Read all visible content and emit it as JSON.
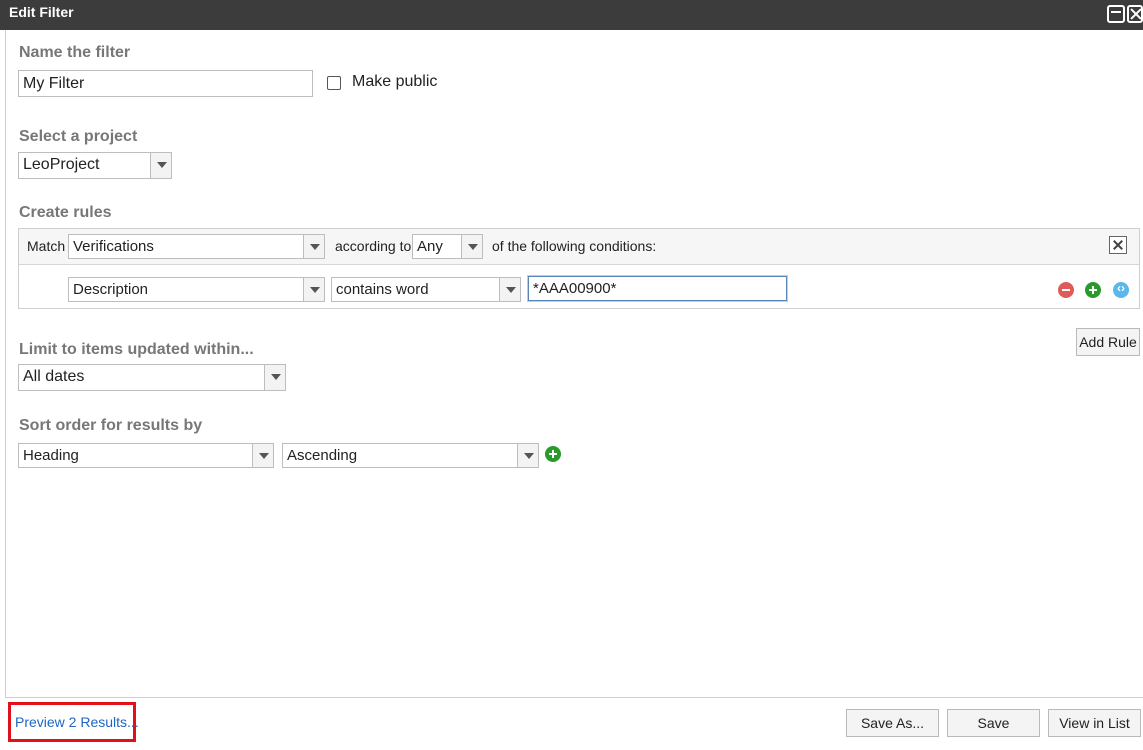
{
  "window": {
    "title": "Edit Filter"
  },
  "name_section": {
    "label": "Name the filter",
    "filter_name": "My Filter",
    "make_public_label": "Make public",
    "make_public_checked": false
  },
  "project_section": {
    "label": "Select a project",
    "selected": "LeoProject"
  },
  "rules_section": {
    "label": "Create rules",
    "match_label": "Match",
    "match_type": "Verifications",
    "according_to_label": "according to",
    "quantifier": "Any",
    "conditions_label": "of the following conditions:",
    "rules": [
      {
        "field": "Description",
        "operator": "contains word",
        "value": "*AAA00900*"
      }
    ],
    "add_rule_label": "Add Rule"
  },
  "limit_section": {
    "label": "Limit to items updated within...",
    "selected": "All dates"
  },
  "sort_section": {
    "label": "Sort order for results by",
    "field": "Heading",
    "direction": "Ascending"
  },
  "footer": {
    "preview_link": "Preview 2 Results...",
    "save_as_label": "Save As...",
    "save_label": "Save",
    "view_in_list_label": "View in List"
  },
  "colors": {
    "titlebar": "#3c3c3c",
    "link": "#1f66c2",
    "highlight_box": "#e1101a",
    "remove_icon": "#e05a5a",
    "add_icon": "#2a9a2a",
    "nest_icon": "#5bb8ea"
  }
}
